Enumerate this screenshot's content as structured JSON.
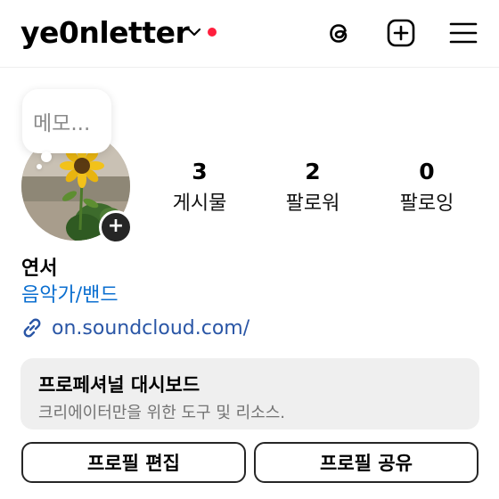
{
  "header": {
    "username": "ye0nletter",
    "icons": {
      "threads": "threads-icon",
      "new_post": "plus-square-icon",
      "menu": "hamburger-menu-icon"
    },
    "notification_color": "#ff1f3d"
  },
  "memo": {
    "placeholder": "메모..."
  },
  "stats": [
    {
      "value": "3",
      "label": "게시물"
    },
    {
      "value": "2",
      "label": "팔로워"
    },
    {
      "value": "0",
      "label": "팔로잉"
    }
  ],
  "profile": {
    "name": "연서",
    "category": "음악가/밴드",
    "category_color": "#0b6fd0",
    "link": "on.soundcloud.com/",
    "link_color": "#2a56a6"
  },
  "dashboard": {
    "title": "프로페셔널 대시보드",
    "subtitle": "크리에이터만을 위한 도구 및 리소스."
  },
  "buttons": {
    "edit_profile": "프로필 편집",
    "share_profile": "프로필 공유"
  }
}
